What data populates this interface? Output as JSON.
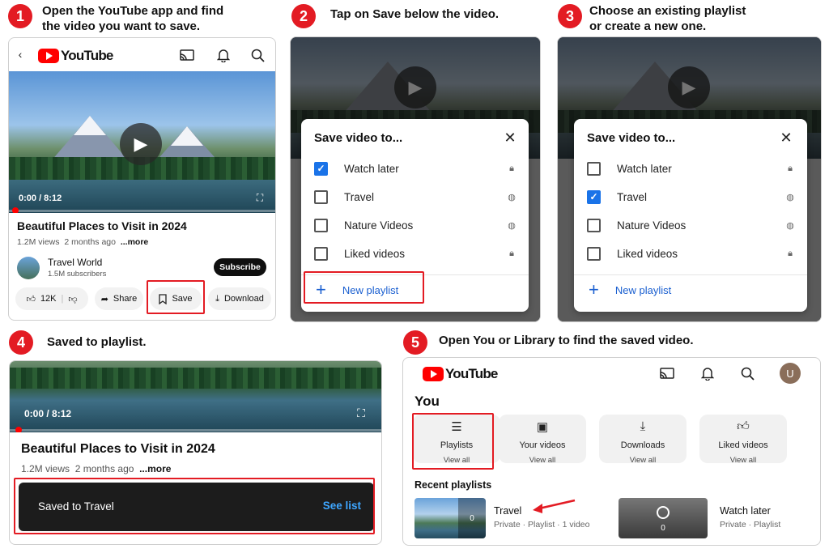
{
  "steps": [
    {
      "num": "1",
      "title_line1": "Open the YouTube app and find",
      "title_line2": "the video you want to save."
    },
    {
      "num": "2",
      "title_line1": "Tap on Save below the video."
    },
    {
      "num": "3",
      "title_line1": "Choose an existing playlist",
      "title_line2": "or create a new one."
    },
    {
      "num": "4",
      "title_line1": "Saved to playlist."
    },
    {
      "num": "5",
      "title_line1": "Open You or Library to find the saved video."
    }
  ],
  "brand": {
    "logo_text": "YouTube",
    "red": "#ff0000",
    "accent_red": "#e31b23",
    "link_blue": "#1a5fd0"
  },
  "video": {
    "time": "0:00 / 8:12",
    "title": "Beautiful Places to Visit in 2024",
    "views": "1.2M views",
    "age": "2 months ago",
    "more": "...more",
    "channel": "Travel World",
    "subscribers": "1.5M subscribers",
    "subscribe_label": "Subscribe",
    "likes": "12K",
    "share_label": "Share",
    "save_label": "Save",
    "download_label": "Download",
    "progress": 0.0
  },
  "dialog": {
    "title": "Save video to...",
    "new_playlist": "New playlist",
    "items": [
      {
        "label": "Watch later",
        "icon": "lock-icon"
      },
      {
        "label": "Travel",
        "icon": "globe-icon"
      },
      {
        "label": "Nature Videos",
        "icon": "globe-icon"
      },
      {
        "label": "Liked videos",
        "icon": "lock-icon"
      }
    ],
    "step2_checked": [
      true,
      false,
      false,
      false
    ],
    "step3_checked": [
      false,
      true,
      false,
      false
    ]
  },
  "toast": {
    "message": "Saved to Travel",
    "action": "See list"
  },
  "library": {
    "heading": "You",
    "avatar_letter": "U",
    "tiles": [
      {
        "label": "Playlists",
        "sub": "View all",
        "icon": "playlist-icon"
      },
      {
        "label": "Your videos",
        "sub": "View all",
        "icon": "play-square-icon"
      },
      {
        "label": "Downloads",
        "sub": "View all",
        "icon": "download-icon"
      },
      {
        "label": "Liked videos",
        "sub": "View all",
        "icon": "thumbs-up-icon"
      }
    ],
    "recent_heading": "Recent playlists",
    "recent": [
      {
        "name": "Travel",
        "meta": "Private · Playlist · 1 video",
        "count": "0"
      },
      {
        "name": "Watch later",
        "meta": "Private · Playlist",
        "count": "0"
      }
    ]
  }
}
